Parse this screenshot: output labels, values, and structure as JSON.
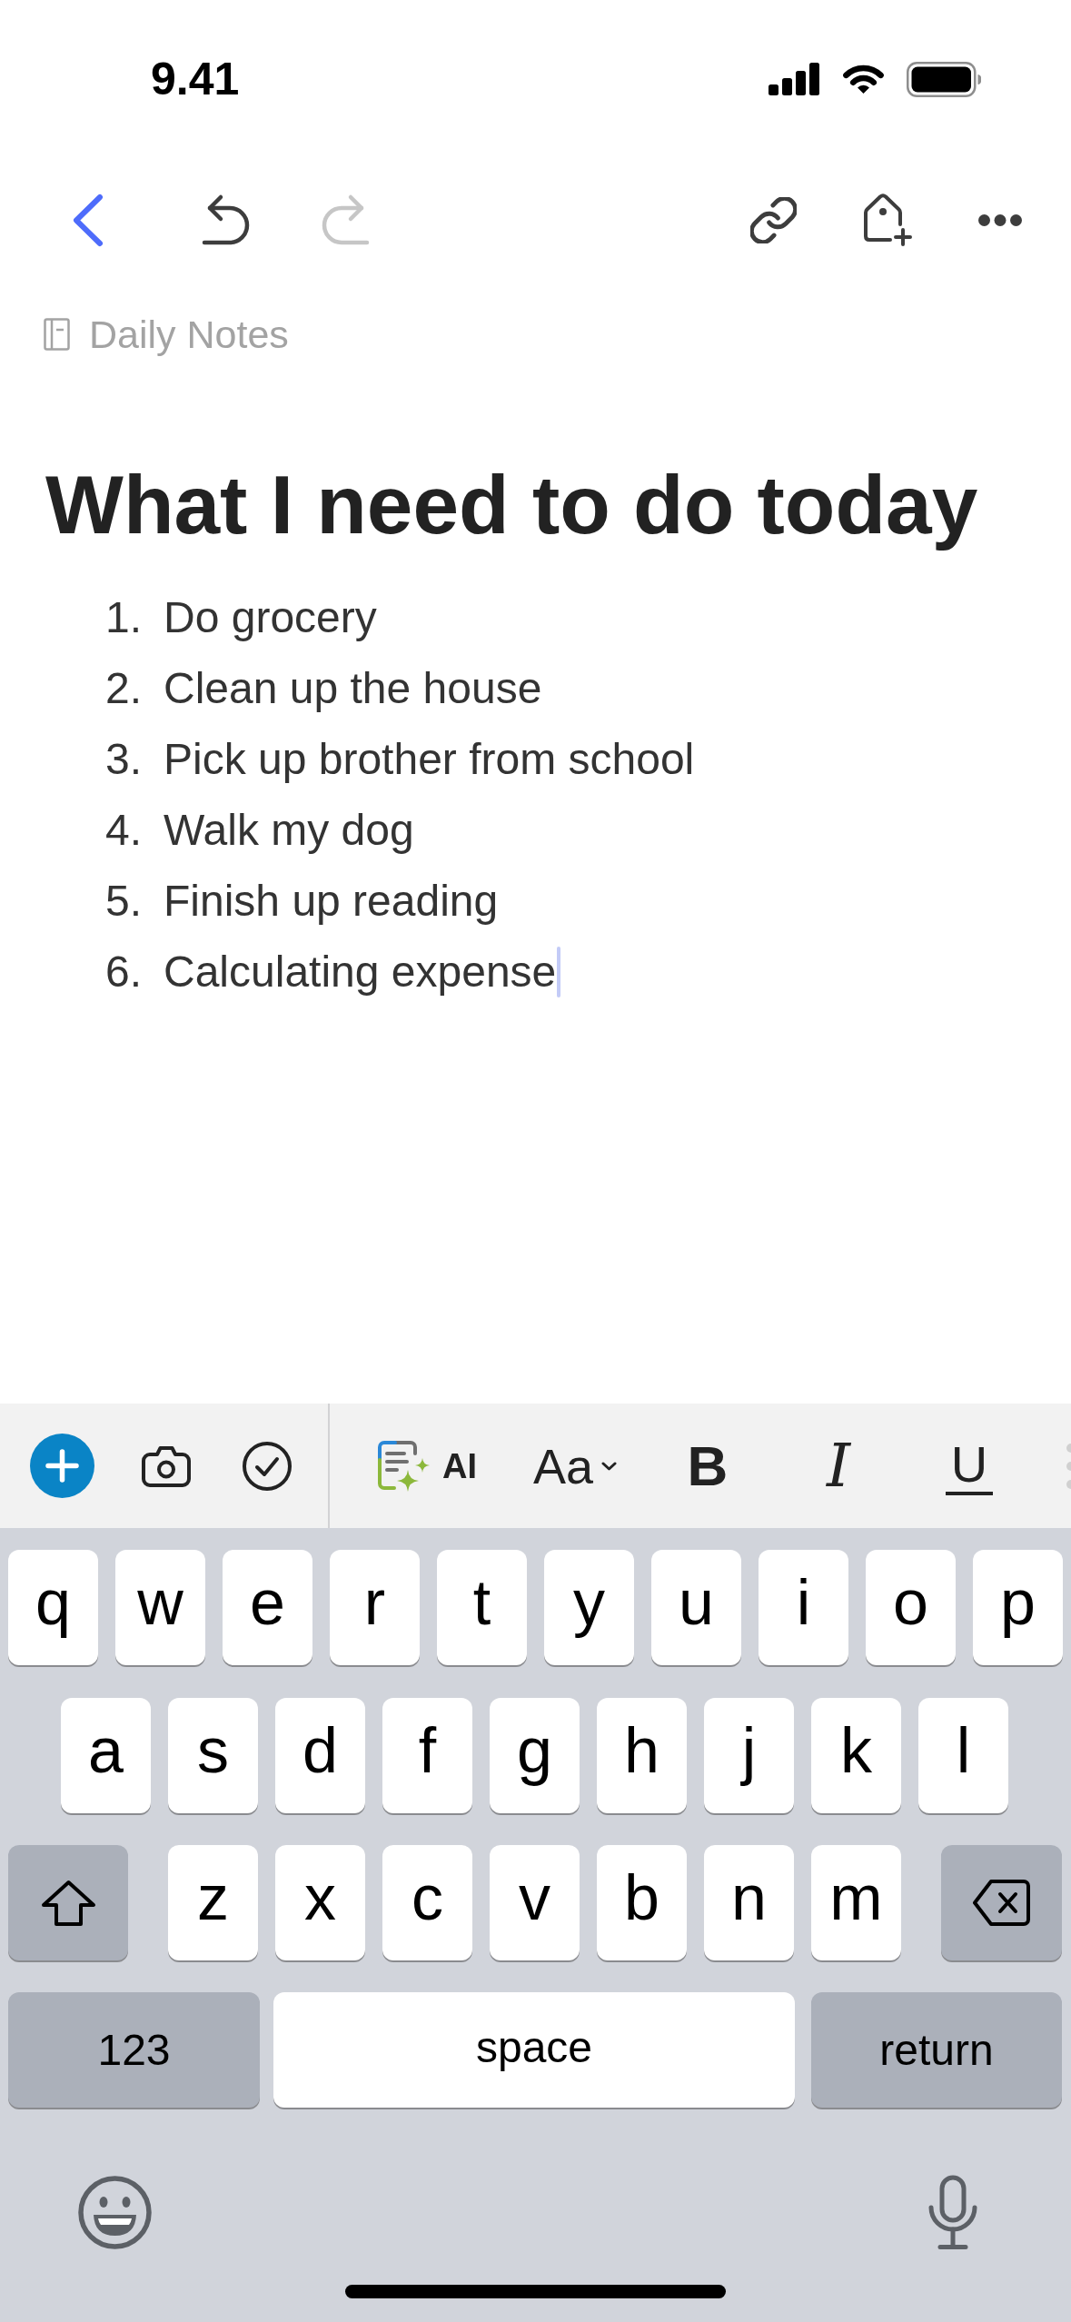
{
  "status_bar": {
    "time": "9.41"
  },
  "toolbar": {
    "undo": {
      "disabled": false
    },
    "redo": {
      "disabled": true
    }
  },
  "breadcrumb": {
    "label": "Daily Notes"
  },
  "note": {
    "title": "What I need to do today",
    "items": [
      {
        "number": "1.",
        "text": "Do grocery",
        "cursor": false
      },
      {
        "number": "2.",
        "text": "Clean up the house",
        "cursor": false
      },
      {
        "number": "3.",
        "text": "Pick up brother from school",
        "cursor": false
      },
      {
        "number": "4.",
        "text": "Walk my dog",
        "cursor": false
      },
      {
        "number": "5.",
        "text": "Finish up reading",
        "cursor": false
      },
      {
        "number": "6.",
        "text": "Calculating expense",
        "cursor": true
      }
    ]
  },
  "format_bar": {
    "insert_tools": [
      {
        "kind": "add"
      },
      {
        "kind": "camera"
      },
      {
        "kind": "task"
      }
    ],
    "style_tools": [
      {
        "kind": "ai",
        "label": "AI"
      },
      {
        "kind": "text_style",
        "label": "Aa"
      },
      {
        "kind": "bold",
        "label": "B"
      },
      {
        "kind": "italic",
        "label": "I"
      },
      {
        "kind": "underline",
        "label": "U"
      }
    ]
  },
  "keyboard": {
    "letter_rows": [
      [
        "q",
        "w",
        "e",
        "r",
        "t",
        "y",
        "u",
        "i",
        "o",
        "p"
      ],
      [
        "a",
        "s",
        "d",
        "f",
        "g",
        "h",
        "j",
        "k",
        "l"
      ],
      [
        "z",
        "x",
        "c",
        "v",
        "b",
        "n",
        "m"
      ]
    ],
    "shift_on": false,
    "bottom_row": [
      {
        "kind": "function",
        "label": "123"
      },
      {
        "kind": "space",
        "label": "space"
      },
      {
        "kind": "function",
        "label": "return"
      }
    ]
  }
}
